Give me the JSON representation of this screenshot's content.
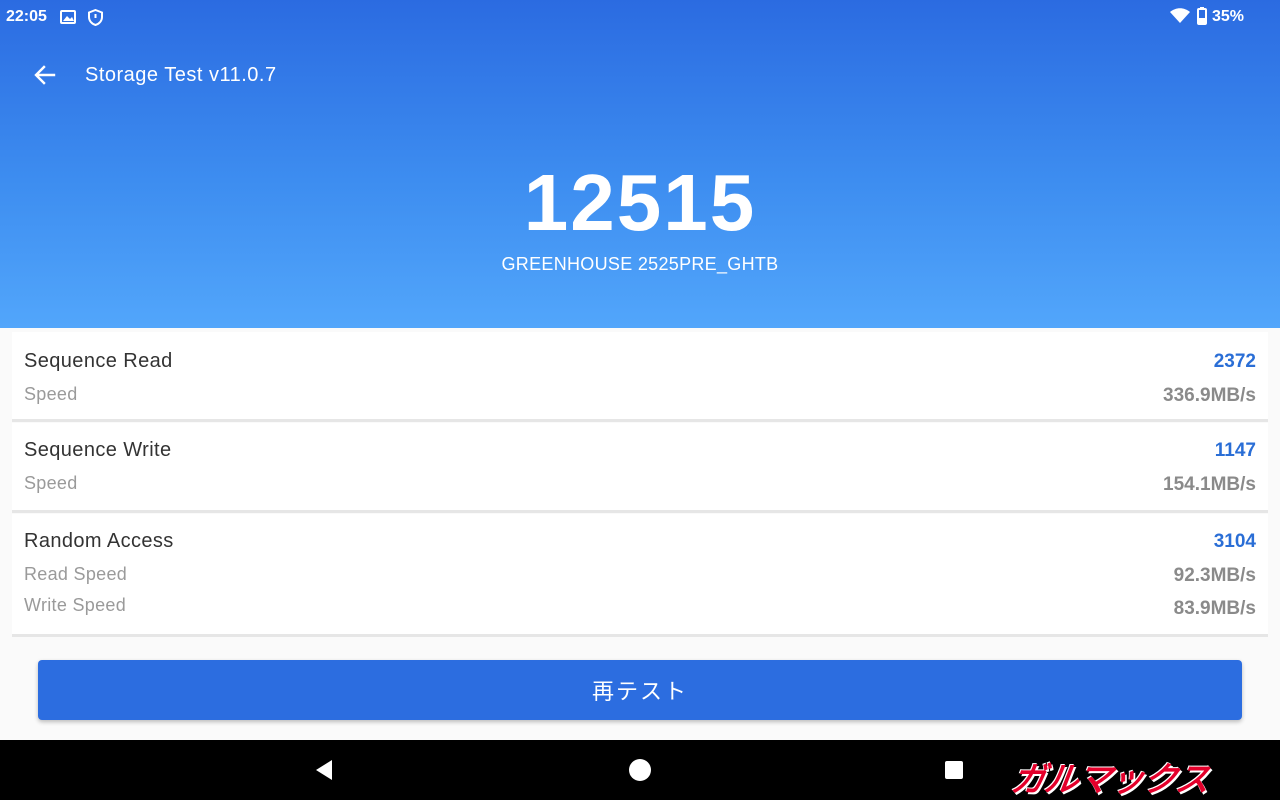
{
  "status_bar": {
    "time": "22:05",
    "battery": "35%",
    "icons": [
      "image-icon",
      "shield-icon",
      "wifi-icon",
      "battery-icon"
    ]
  },
  "toolbar": {
    "title": "Storage Test v11.0.7",
    "back_icon": "arrow-left-icon"
  },
  "summary": {
    "score": "12515",
    "device": "GREENHOUSE 2525PRE_GHTB"
  },
  "results": [
    {
      "title": "Sequence Read",
      "score": "2372",
      "metrics": [
        {
          "label": "Speed",
          "value": "336.9MB/s"
        }
      ]
    },
    {
      "title": "Sequence Write",
      "score": "1147",
      "metrics": [
        {
          "label": "Speed",
          "value": "154.1MB/s"
        }
      ]
    },
    {
      "title": "Random Access",
      "score": "3104",
      "metrics": [
        {
          "label": "Read Speed",
          "value": "92.3MB/s"
        },
        {
          "label": "Write Speed",
          "value": "83.9MB/s"
        }
      ]
    }
  ],
  "retest_button": {
    "label": "再テスト"
  },
  "watermark": "ガルマックス",
  "colors": {
    "header_top": "#2b6be1",
    "header_bottom": "#52a6fb",
    "score_blue": "#2a6ed6",
    "button_blue": "#2c6de0",
    "watermark_red": "#e4002b"
  }
}
